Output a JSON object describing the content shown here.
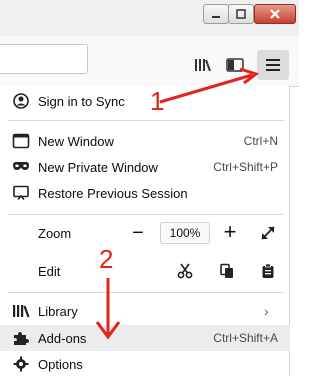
{
  "window": {
    "buttons": [
      "minimize",
      "maximize",
      "close"
    ]
  },
  "toolbar": {
    "icons": [
      "library-icon",
      "sidebar-icon",
      "hamburger-menu-icon"
    ]
  },
  "menu": {
    "sign_in": "Sign in to Sync",
    "new_window": {
      "label": "New Window",
      "shortcut": "Ctrl+N"
    },
    "new_private_window": {
      "label": "New Private Window",
      "shortcut": "Ctrl+Shift+P"
    },
    "restore_session": {
      "label": "Restore Previous Session"
    },
    "zoom": {
      "label": "Zoom",
      "minus": "−",
      "value": "100%",
      "plus": "+"
    },
    "edit": {
      "label": "Edit"
    },
    "library": {
      "label": "Library",
      "chevron": "›"
    },
    "addons": {
      "label": "Add-ons",
      "shortcut": "Ctrl+Shift+A"
    },
    "options": {
      "label": "Options"
    }
  },
  "annotations": {
    "step1": "1",
    "step2": "2",
    "color": "#e2251c"
  }
}
